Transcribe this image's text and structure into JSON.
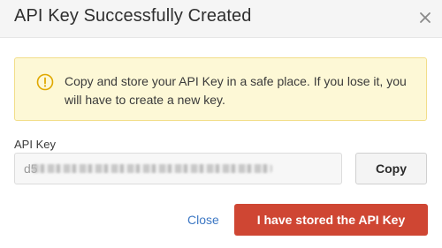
{
  "modal": {
    "title": "API Key Successfully Created",
    "close_icon": "close-icon"
  },
  "alert": {
    "icon": "warning-circle-icon",
    "message": "Copy and store your API Key in a safe place. If you lose it, you will have to create a new key."
  },
  "api_key": {
    "label": "API Key",
    "value": "d5",
    "obscured": true
  },
  "actions": {
    "copy_label": "Copy",
    "close_label": "Close",
    "confirm_label": "I have stored the API Key"
  },
  "colors": {
    "primary": "#cf4633",
    "link": "#3d78c4",
    "alert_bg": "#fdf8d6",
    "alert_border": "#f2de8a",
    "alert_icon": "#e0a800"
  }
}
